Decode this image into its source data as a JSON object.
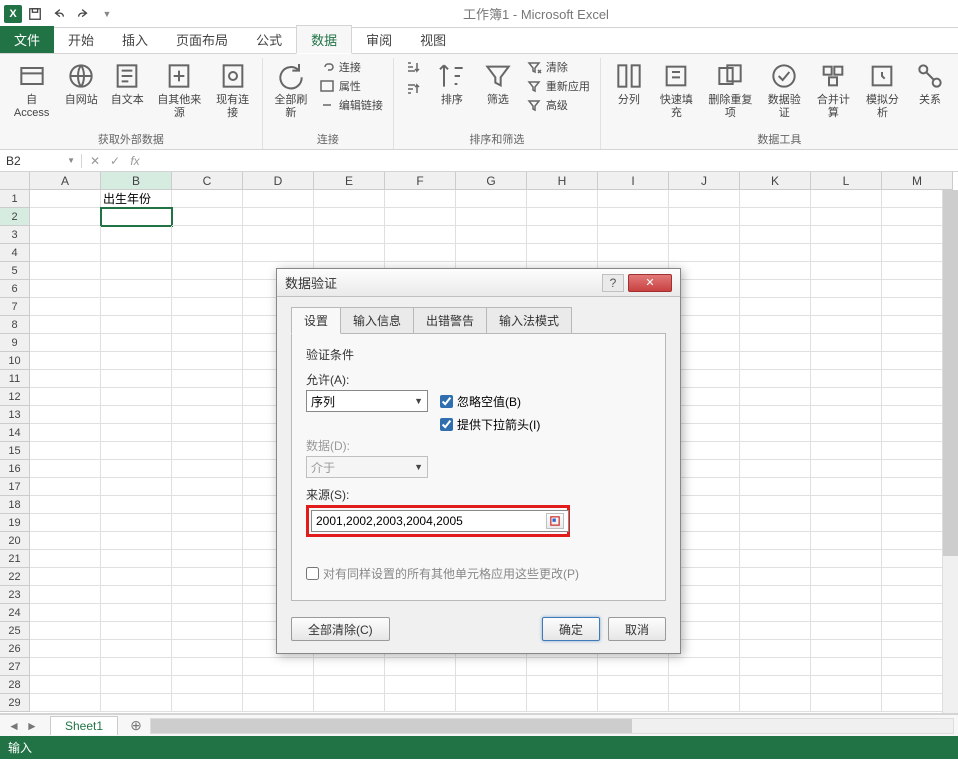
{
  "app": {
    "title": "工作簿1 - Microsoft Excel"
  },
  "ribbonTabs": {
    "file": "文件",
    "items": [
      "开始",
      "插入",
      "页面布局",
      "公式",
      "数据",
      "审阅",
      "视图"
    ],
    "activeIndex": 4
  },
  "ribbon": {
    "group1": {
      "label": "获取外部数据",
      "btns": [
        "自 Access",
        "自网站",
        "自文本",
        "自其他来源",
        "现有连接"
      ]
    },
    "group2": {
      "label": "连接",
      "refresh": "全部刷新",
      "items": [
        "连接",
        "属性",
        "编辑链接"
      ]
    },
    "group3": {
      "label": "排序和筛选",
      "sort": "排序",
      "filter": "筛选",
      "items": [
        "清除",
        "重新应用",
        "高级"
      ]
    },
    "group4": {
      "label": "数据工具",
      "btns": [
        "分列",
        "快速填充",
        "删除重复项",
        "数据验证",
        "合并计算",
        "模拟分析",
        "关系"
      ]
    }
  },
  "nameBox": "B2",
  "columns": [
    "A",
    "B",
    "C",
    "D",
    "E",
    "F",
    "G",
    "H",
    "I",
    "J",
    "K",
    "L",
    "M"
  ],
  "rowCount": 29,
  "cells": {
    "B1": "出生年份"
  },
  "selectedCell": "B2",
  "sheetTab": "Sheet1",
  "status": "输入",
  "dialog": {
    "title": "数据验证",
    "tabs": [
      "设置",
      "输入信息",
      "出错警告",
      "输入法模式"
    ],
    "activeTab": 0,
    "sectionTitle": "验证条件",
    "allowLabel": "允许(A):",
    "allowValue": "序列",
    "ignoreBlank": "忽略空值(B)",
    "inCellDropdown": "提供下拉箭头(I)",
    "dataLabel": "数据(D):",
    "dataValue": "介于",
    "sourceLabel": "来源(S):",
    "sourceValue": "2001,2002,2003,2004,2005",
    "applyAll": "对有同样设置的所有其他单元格应用这些更改(P)",
    "clearAll": "全部清除(C)",
    "ok": "确定",
    "cancel": "取消"
  }
}
